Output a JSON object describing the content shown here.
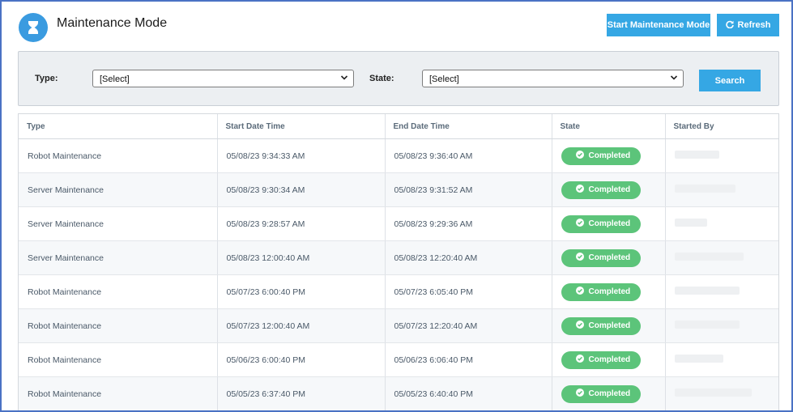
{
  "header": {
    "title": "Maintenance Mode",
    "start_button": "Start Maintenance Mode",
    "refresh_button": "Refresh"
  },
  "filters": {
    "type_label": "Type:",
    "type_value": "[Select]",
    "state_label": "State:",
    "state_value": "[Select]",
    "search_button": "Search"
  },
  "table": {
    "columns": [
      "Type",
      "Start Date Time",
      "End Date Time",
      "State",
      "Started By"
    ],
    "rows": [
      {
        "type": "Robot Maintenance",
        "start": "05/08/23 9:34:33 AM",
        "end": "05/08/23 9:36:40 AM",
        "state": "Completed"
      },
      {
        "type": "Server Maintenance",
        "start": "05/08/23 9:30:34 AM",
        "end": "05/08/23 9:31:52 AM",
        "state": "Completed"
      },
      {
        "type": "Server Maintenance",
        "start": "05/08/23 9:28:57 AM",
        "end": "05/08/23 9:29:36 AM",
        "state": "Completed"
      },
      {
        "type": "Server Maintenance",
        "start": "05/08/23 12:00:40 AM",
        "end": "05/08/23 12:20:40 AM",
        "state": "Completed"
      },
      {
        "type": "Robot Maintenance",
        "start": "05/07/23 6:00:40 PM",
        "end": "05/07/23 6:05:40 PM",
        "state": "Completed"
      },
      {
        "type": "Robot Maintenance",
        "start": "05/07/23 12:00:40 AM",
        "end": "05/07/23 12:20:40 AM",
        "state": "Completed"
      },
      {
        "type": "Robot Maintenance",
        "start": "05/06/23 6:00:40 PM",
        "end": "05/06/23 6:06:40 PM",
        "state": "Completed"
      },
      {
        "type": "Robot Maintenance",
        "start": "05/05/23 6:37:40 PM",
        "end": "05/05/23 6:40:40 PM",
        "state": "Completed"
      }
    ]
  },
  "colors": {
    "accent": "#35a7e4",
    "completed": "#5cc47a",
    "border": "#4a72c4"
  },
  "icons": {
    "logo": "hourglass-icon",
    "refresh": "refresh-icon",
    "select": "chevron-down-icon",
    "state": "check-circle-icon"
  }
}
